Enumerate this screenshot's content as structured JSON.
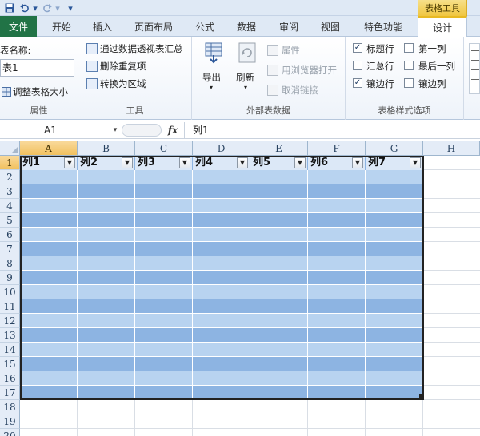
{
  "quick_access": {
    "menu_glyph": "▾"
  },
  "context_tab_group": "表格工具",
  "tabs": {
    "file": "文件",
    "items": [
      "开始",
      "插入",
      "页面布局",
      "公式",
      "数据",
      "审阅",
      "视图",
      "特色功能",
      "设计"
    ],
    "active": "设计"
  },
  "ribbon": {
    "properties": {
      "label": "属性",
      "table_name_label": "表名称:",
      "table_name_value": "表1",
      "resize_label": "调整表格大小"
    },
    "tools": {
      "label": "工具",
      "items": [
        "通过数据透视表汇总",
        "删除重复项",
        "转换为区域"
      ]
    },
    "external": {
      "label": "外部表数据",
      "export_label": "导出",
      "refresh_label": "刷新",
      "properties_label": "属性",
      "open_browser_label": "用浏览器打开",
      "unlink_label": "取消链接"
    },
    "style_options": {
      "label": "表格样式选项",
      "options": [
        {
          "label": "标题行",
          "checked": true
        },
        {
          "label": "第一列",
          "checked": false
        },
        {
          "label": "汇总行",
          "checked": false
        },
        {
          "label": "最后一列",
          "checked": false
        },
        {
          "label": "镶边行",
          "checked": true
        },
        {
          "label": "镶边列",
          "checked": false
        }
      ]
    }
  },
  "formula_bar": {
    "name_box": "A1",
    "fx": "fx",
    "formula": "列1"
  },
  "grid": {
    "columns": [
      "A",
      "B",
      "C",
      "D",
      "E",
      "F",
      "G",
      "H"
    ],
    "rows": [
      "1",
      "2",
      "3",
      "4",
      "5",
      "6",
      "7",
      "8",
      "9",
      "10",
      "11",
      "12",
      "13",
      "14",
      "15",
      "16",
      "17",
      "18",
      "19",
      "20"
    ],
    "selected_column": "A",
    "selected_row": "1",
    "table_headers": [
      "列1",
      "列2",
      "列3",
      "列4",
      "列5",
      "列6",
      "列7"
    ],
    "filter_glyph": "▼"
  },
  "colors": {
    "band_dark": "#8db4e2",
    "band_light": "#b8d3f0",
    "file_tab": "#217346",
    "context_tab": "#f0c640"
  }
}
